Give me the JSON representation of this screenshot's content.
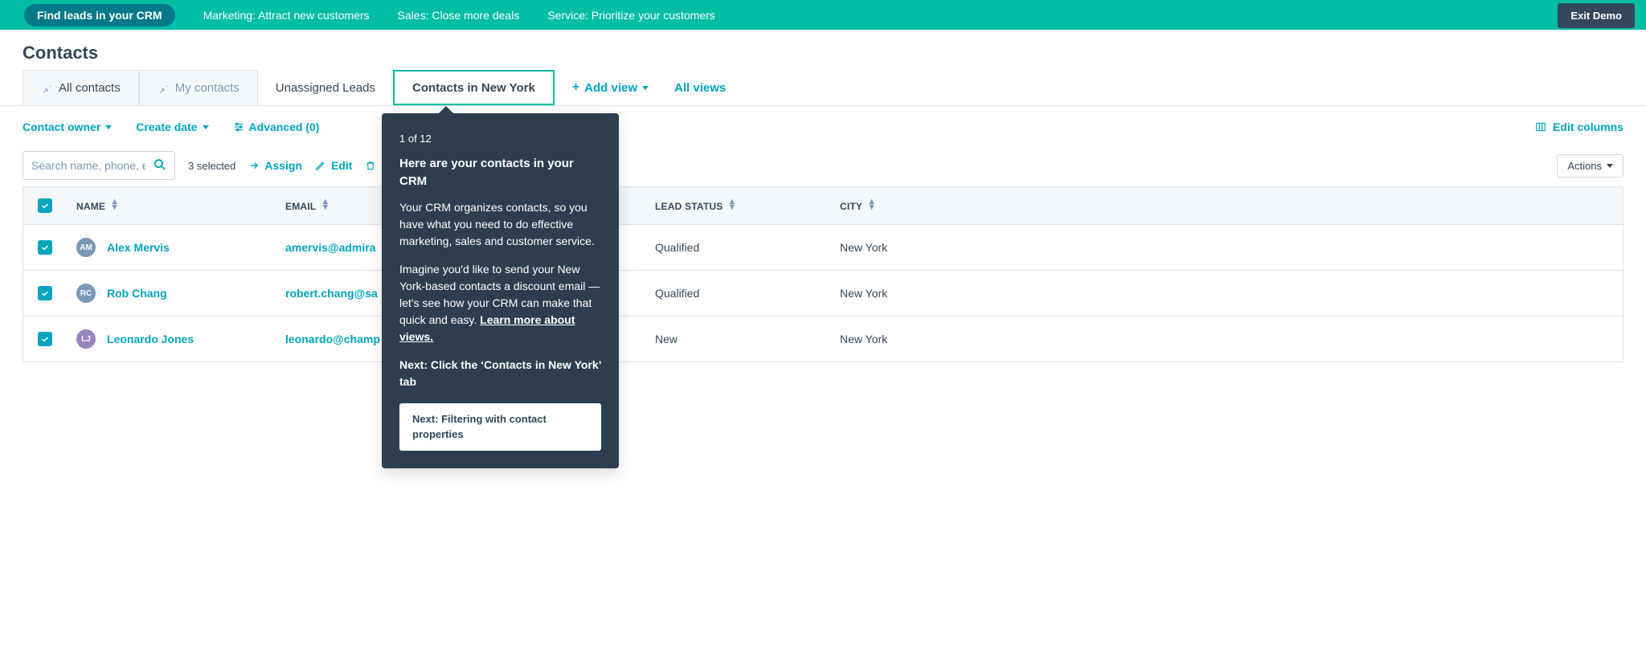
{
  "banner": {
    "pill": "Find leads in your CRM",
    "items": [
      "Marketing: Attract new customers",
      "Sales: Close more deals",
      "Service: Prioritize your customers"
    ],
    "exit": "Exit Demo"
  },
  "page_title": "Contacts",
  "tabs": {
    "all_contacts": "All contacts",
    "my_contacts": "My contacts",
    "unassigned": "Unassigned Leads",
    "contacts_ny": "Contacts in New York",
    "add_view": "Add view",
    "all_views": "All views"
  },
  "filters": {
    "contact_owner": "Contact owner",
    "create_date": "Create date",
    "advanced": "Advanced (0)",
    "edit_columns": "Edit columns"
  },
  "actionbar": {
    "search_placeholder": "Search name, phone, email",
    "selected": "3 selected",
    "assign": "Assign",
    "edit": "Edit",
    "delete": "D",
    "actions": "Actions"
  },
  "columns": {
    "name": "NAME",
    "email": "EMAIL",
    "lead_status": "LEAD STATUS",
    "city": "CITY"
  },
  "rows": [
    {
      "initials": "AM",
      "avatar_color": "#7c98b6",
      "name": "Alex Mervis",
      "email": "amervis@admira",
      "lead_status": "Qualified",
      "city": "New York"
    },
    {
      "initials": "RC",
      "avatar_color": "#7c98b6",
      "name": "Rob Chang",
      "email": "robert.chang@sa",
      "lead_status": "Qualified",
      "city": "New York"
    },
    {
      "initials": "LJ",
      "avatar_color": "#9784c2",
      "name": "Leonardo Jones",
      "email": "leonardo@champ",
      "lead_status": "New",
      "city": "New York"
    }
  ],
  "popover": {
    "count": "1 of 12",
    "title": "Here are your contacts in your CRM",
    "body1": "Your CRM organizes contacts, so you have what you need to do effective marketing, sales and customer service.",
    "body2": "Imagine you'd like to send your New York-based contacts a discount email — let's see how your CRM can make that quick and easy.",
    "learn_more": "Learn more about views.",
    "next_line": "Next: Click the ‘Contacts in New York’ tab",
    "next_btn": "Next: Filtering with contact properties"
  }
}
